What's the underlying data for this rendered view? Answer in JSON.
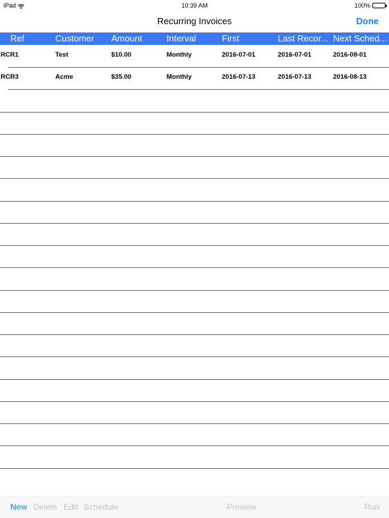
{
  "status_bar": {
    "device": "iPad",
    "time": "10:39 AM",
    "battery": "100%",
    "battery_level": 1.0,
    "wifi_icon": "wifi-icon"
  },
  "nav": {
    "title": "Recurring Invoices",
    "done_label": "Done"
  },
  "table": {
    "columns": [
      "Ref",
      "Customer",
      "Amount",
      "Interval",
      "First",
      "Last Recor...",
      "Next Sched..."
    ],
    "rows": [
      [
        "RCR1",
        "Test",
        "$10.00",
        "Monthly",
        "2016-07-01",
        "2016-07-01",
        "2016-08-01"
      ],
      [
        "RCR3",
        "Acme",
        "$35.00",
        "Monthly",
        "2016-07-13",
        "2016-07-13",
        "2016-08-13"
      ]
    ]
  },
  "toolbar": {
    "new_label": "New",
    "delete_label": "Delete",
    "edit_label": "Edit",
    "schedule_label": "Schedule",
    "preview_label": "Preview",
    "run_label": "Run"
  },
  "colors": {
    "header_bg": "#3c78f2",
    "accent": "#1a7cf5",
    "disabled": "#c2c2c2"
  }
}
